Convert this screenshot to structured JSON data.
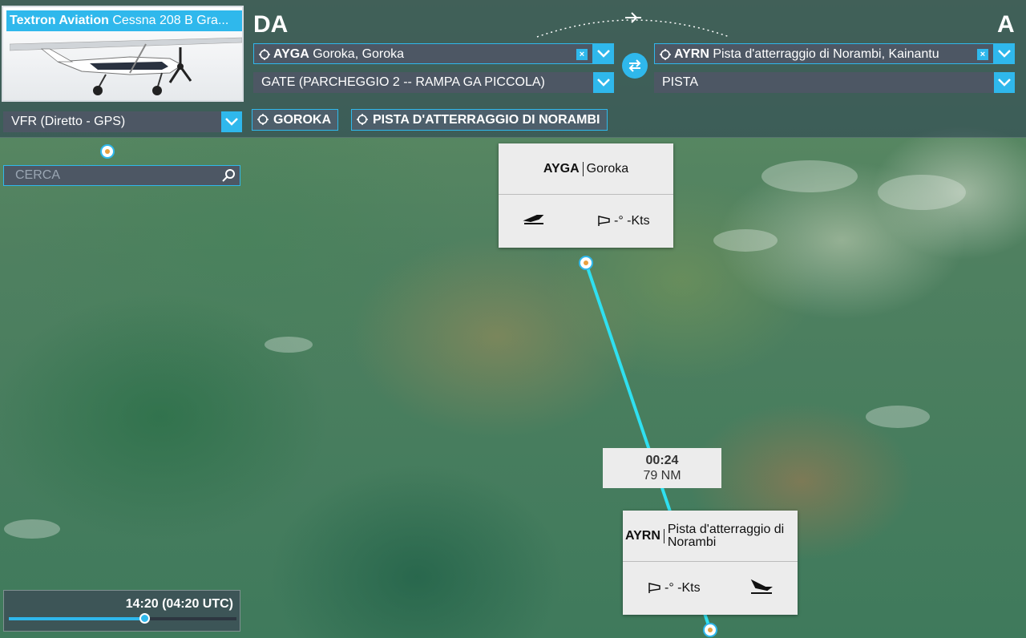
{
  "aircraft": {
    "brand": "Textron Aviation",
    "model": "Cessna 208 B Gra..."
  },
  "departure": {
    "section_label": "DA",
    "icao": "AYGA",
    "name": "Goroka, Goroka",
    "parking": "GATE (PARCHEGGIO 2 -- RAMPA GA PICCOLA)",
    "map_button": "GOROKA"
  },
  "arrival": {
    "section_label": "A",
    "icao": "AYRN",
    "name": "Pista d'atterraggio di Norambi, Kainantu",
    "parking": "PISTA",
    "map_button": "PISTA D'ATTERRAGGIO DI NORAMBI"
  },
  "flight_type": "VFR (Diretto - GPS)",
  "search": {
    "placeholder": "CERCA"
  },
  "map": {
    "departure_card": {
      "icao": "AYGA",
      "name": "Goroka",
      "wind": "-° -Kts"
    },
    "arrival_card": {
      "icao": "AYRN",
      "name": "Pista d'atterraggio di Norambi",
      "wind": "-° -Kts"
    },
    "leg": {
      "time": "00:24",
      "distance": "79 NM"
    },
    "route_color": "#2fe0f0"
  },
  "time_of_day": {
    "label": "14:20 (04:20 UTC)",
    "fraction": 0.6
  },
  "colors": {
    "accent": "#2fb8ec",
    "panel": "#4d5764"
  }
}
